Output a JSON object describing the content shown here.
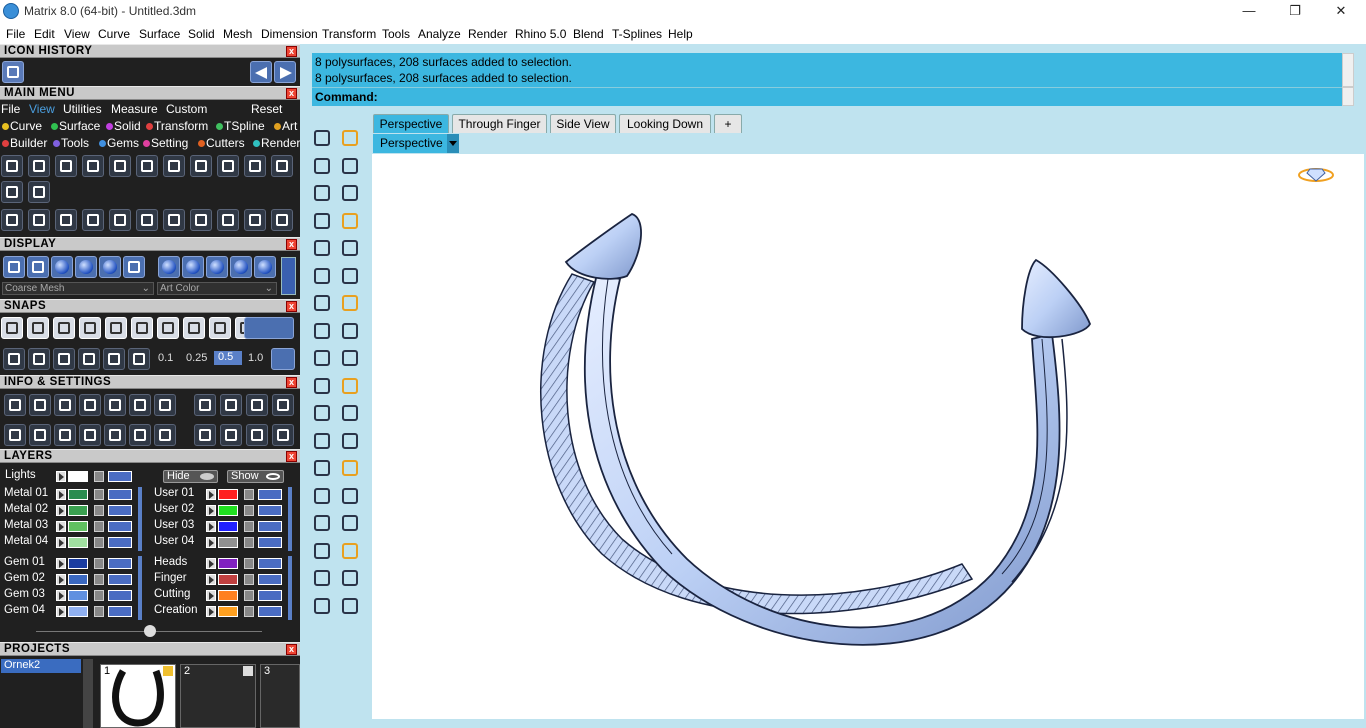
{
  "window": {
    "title": "Matrix 8.0 (64-bit) - Untitled.3dm"
  },
  "menubar": [
    "File",
    "Edit",
    "View",
    "Curve",
    "Surface",
    "Solid",
    "Mesh",
    "Dimension",
    "Transform",
    "Tools",
    "Analyze",
    "Render",
    "Rhino 5.0",
    "Blend",
    "T-Splines",
    "Help"
  ],
  "panels": {
    "icon_history": "ICON HISTORY",
    "main_menu": "MAIN MENU",
    "display": "DISPLAY",
    "snaps": "SNAPS",
    "info_settings": "INFO & SETTINGS",
    "layers": "LAYERS",
    "projects": "PROJECTS"
  },
  "main_menu": {
    "tabs": [
      "File",
      "View",
      "Utilities",
      "Measure",
      "Custom"
    ],
    "active_tab": "View",
    "reset": "Reset",
    "row1": [
      {
        "label": "Curve",
        "color": "#e8c020"
      },
      {
        "label": "Surface",
        "color": "#30c050"
      },
      {
        "label": "Solid",
        "color": "#c040e0"
      },
      {
        "label": "Transform",
        "color": "#e04040"
      },
      {
        "label": "TSpline",
        "color": "#40c060"
      },
      {
        "label": "Art",
        "color": "#e0a020"
      }
    ],
    "row2": [
      {
        "label": "Builder",
        "color": "#e04040"
      },
      {
        "label": "Tools",
        "color": "#8060e0"
      },
      {
        "label": "Gems",
        "color": "#4090e0"
      },
      {
        "label": "Setting",
        "color": "#e040a0"
      },
      {
        "label": "Cutters",
        "color": "#e06020"
      },
      {
        "label": "Render",
        "color": "#30c0c0"
      }
    ]
  },
  "display": {
    "mesh_select": "Coarse Mesh",
    "color_select": "Art Color"
  },
  "snaps": {
    "values": [
      "0.1",
      "0.25",
      "0.5",
      "1.0"
    ],
    "active": "0.5"
  },
  "layers": {
    "lights": "Lights",
    "hide": "Hide",
    "show": "Show",
    "left": [
      {
        "name": "Metal 01",
        "color": "#2a8c50"
      },
      {
        "name": "Metal 02",
        "color": "#3aa050"
      },
      {
        "name": "Metal 03",
        "color": "#60c060"
      },
      {
        "name": "Metal 04",
        "color": "#a0e0a0"
      },
      {
        "name": "Gem 01",
        "color": "#1a3ca0"
      },
      {
        "name": "Gem 02",
        "color": "#3a68c0"
      },
      {
        "name": "Gem 03",
        "color": "#6090e0"
      },
      {
        "name": "Gem 04",
        "color": "#90b0f0"
      }
    ],
    "right": [
      {
        "name": "User 01",
        "color": "#ff2020"
      },
      {
        "name": "User 02",
        "color": "#20e020"
      },
      {
        "name": "User 03",
        "color": "#2020ff"
      },
      {
        "name": "User 04",
        "color": "#909090"
      },
      {
        "name": "Heads",
        "color": "#8020c0"
      },
      {
        "name": "Finger",
        "color": "#c04040"
      },
      {
        "name": "Cutting",
        "color": "#ff8020"
      },
      {
        "name": "Creation",
        "color": "#ffa020"
      }
    ]
  },
  "projects": {
    "selected": "Ornek2",
    "slots": [
      "1",
      "2",
      "3"
    ]
  },
  "command": {
    "history": [
      "8 polysurfaces, 208 surfaces added to selection.",
      "8 polysurfaces, 208 surfaces added to selection."
    ],
    "prompt": "Command:",
    "value": ""
  },
  "viewport_tabs": [
    "Perspective",
    "Through Finger",
    "Side View",
    "Looking Down"
  ],
  "active_viewport_tab": "Perspective",
  "viewport_label": "Perspective",
  "colors": {
    "accent": "#3cb7e0",
    "panel_bg": "#202020",
    "dock_bg": "#bfe3ef",
    "model": "#bcd0f5"
  }
}
